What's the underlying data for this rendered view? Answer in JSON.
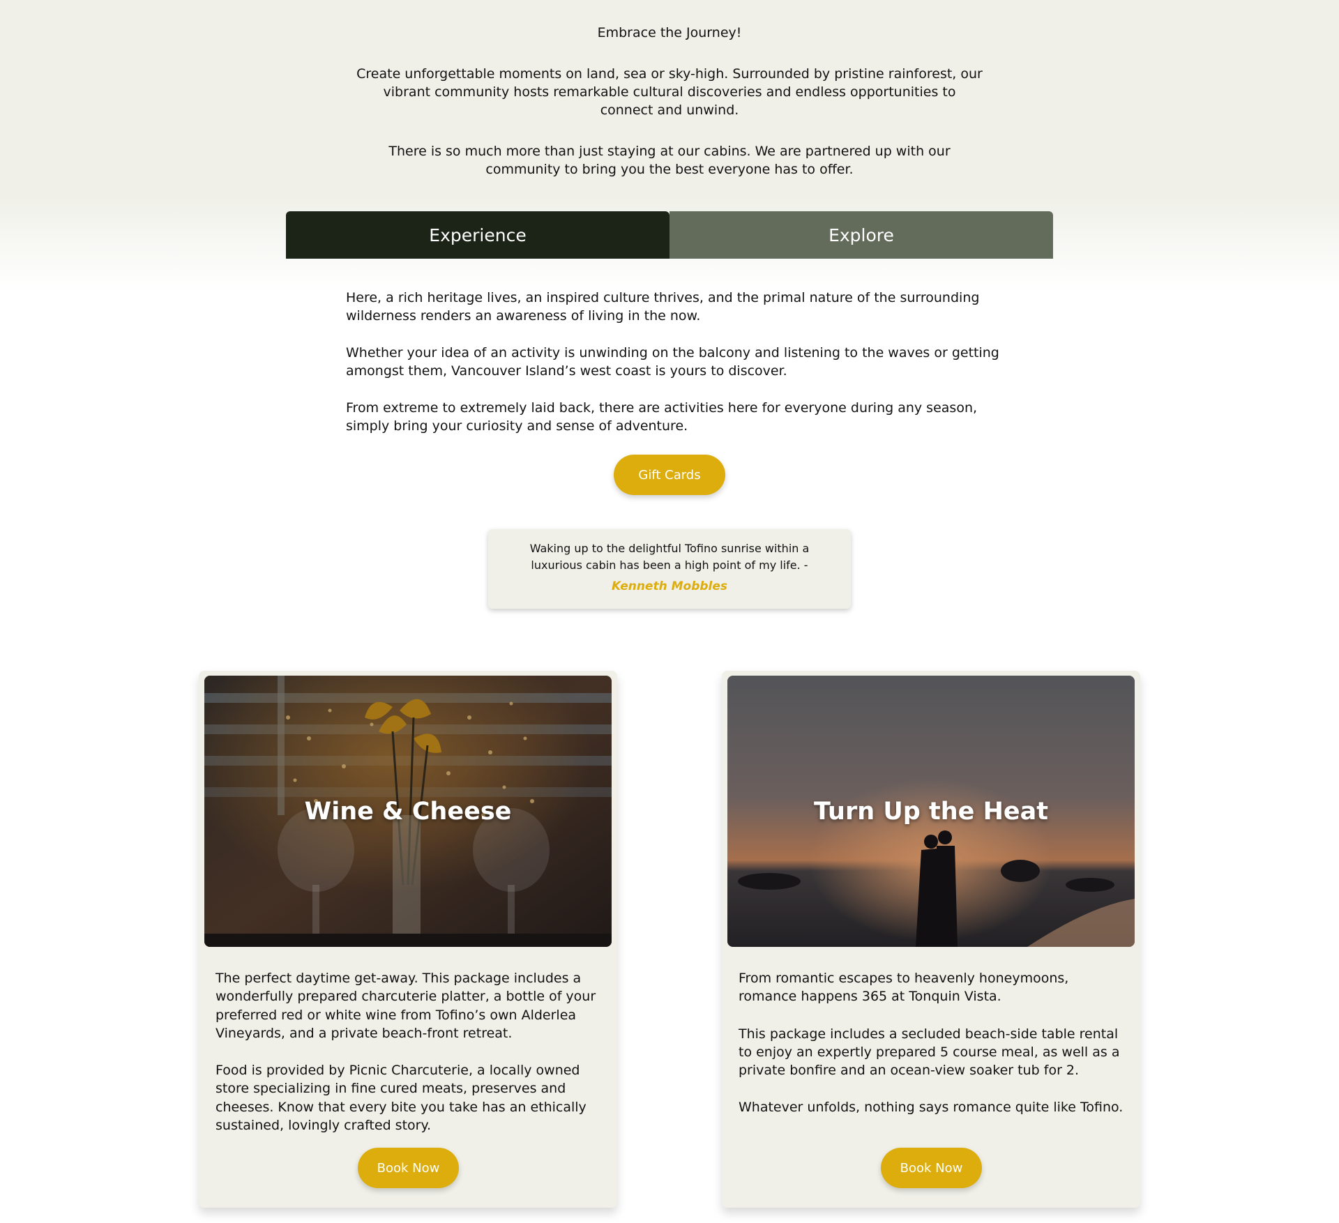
{
  "intro": {
    "heading": "Embrace the Journey!",
    "paragraph1": "Create unforgettable moments on land, sea or sky-high. Surrounded by pristine rainforest, our vibrant community hosts remarkable cultural discoveries and endless opportunities to connect and unwind.",
    "paragraph2": "There is so much more than just staying at our cabins. We are partnered up with our community to bring you the best everyone has to offer."
  },
  "tabs": [
    {
      "label": "Experience",
      "active": true
    },
    {
      "label": "Explore",
      "active": false
    }
  ],
  "experience": {
    "paragraphs": [
      "Here, a rich heritage lives, an inspired culture thrives, and the primal nature of the surrounding wilderness renders an awareness of living in the now.",
      "Whether your idea of an activity is unwinding on the balcony and listening to the waves or getting amongst them, Vancouver Island’s west coast is yours to discover.",
      "From extreme to extremely laid back, there are activities here for everyone during any season, simply bring your curiosity and sense of adventure."
    ],
    "gift_button": "Gift Cards"
  },
  "testimonial": {
    "quote": "Waking up to the delightful Tofino sunrise within a luxurious cabin has been a high point of my life. -",
    "author": "Kenneth Mobbles"
  },
  "cards": [
    {
      "title": "Wine & Cheese",
      "paragraphs": [
        "The perfect daytime get-away. This package includes a wonderfully prepared charcuterie platter, a bottle of your preferred red or white wine from Tofino’s own Alderlea Vineyards, and a private beach-front retreat.",
        "Food is provided by Picnic Charcuterie, a locally owned store specializing in fine cured meats, preserves and cheeses. Know that every bite you take has an ethically sustained, lovingly crafted story."
      ],
      "button": "Book Now"
    },
    {
      "title": "Turn Up the Heat",
      "paragraphs": [
        "From romantic escapes to heavenly honeymoons, romance happens 365 at Tonquin Vista.",
        "This package includes a secluded beach-side table rental to enjoy an expertly prepared 5 course meal, as well as a private bonfire and an ocean-view soaker tub for 2.",
        "Whatever unfolds, nothing says romance quite like Tofino."
      ],
      "button": "Book Now"
    }
  ],
  "colors": {
    "accent": "#dcad0c",
    "tab_active": "#1b2416",
    "tab_inactive": "#636b5a",
    "panel_bg": "#f0f0e9"
  }
}
